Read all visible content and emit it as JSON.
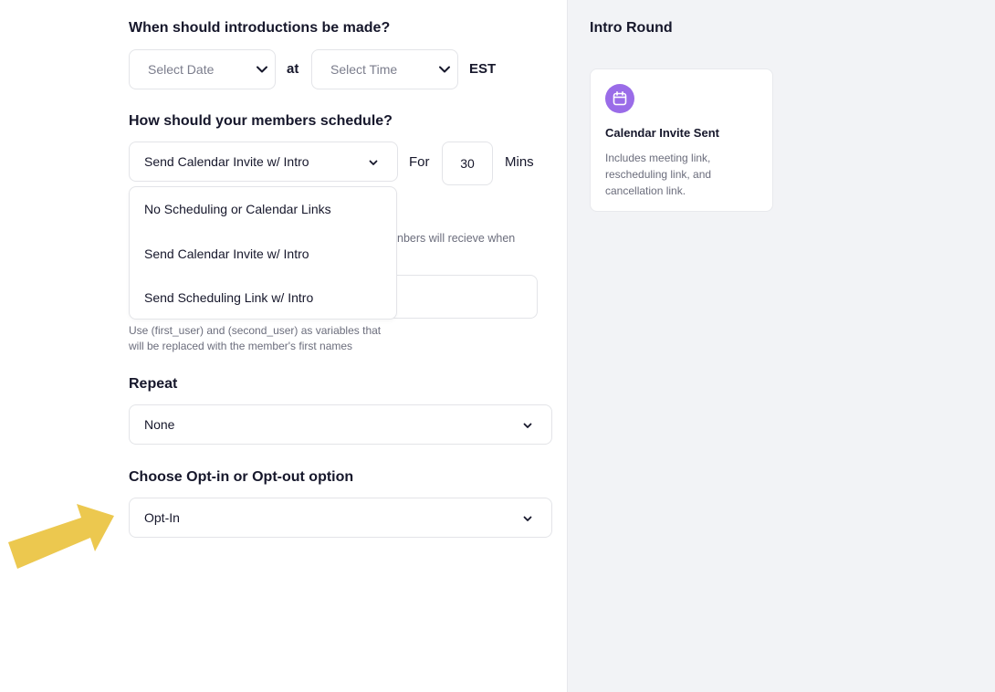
{
  "introductions": {
    "heading": "When should introductions be made?",
    "date_placeholder": "Select Date",
    "at_label": "at",
    "time_placeholder": "Select Time",
    "timezone": "EST"
  },
  "schedule": {
    "heading": "How should your members schedule?",
    "selected": "Send Calendar Invite w/ Intro",
    "for_label": "For",
    "duration": "30",
    "unit": "Mins",
    "options": [
      "No Scheduling or Calendar Links",
      "Send Calendar Invite w/ Intro",
      "Send Scheduling Link w/ Intro"
    ]
  },
  "email": {
    "partial_text": "nbers will recieve when",
    "variables_hint_line1": "Use (first_user) and (second_user) as variables that",
    "variables_hint_line2": "will be replaced with the member's first names"
  },
  "repeat": {
    "heading": "Repeat",
    "selected": "None"
  },
  "optin": {
    "heading": "Choose Opt-in or Opt-out option",
    "selected": "Opt-In"
  },
  "preview": {
    "heading": "Intro Round",
    "card_title": "Calendar Invite Sent",
    "card_description": "Includes meeting link, rescheduling link, and cancellation link.",
    "card_icon": "calendar-icon",
    "accent_color": "#9a6ce8"
  },
  "annotation": {
    "arrow_color": "#ecc84f"
  }
}
